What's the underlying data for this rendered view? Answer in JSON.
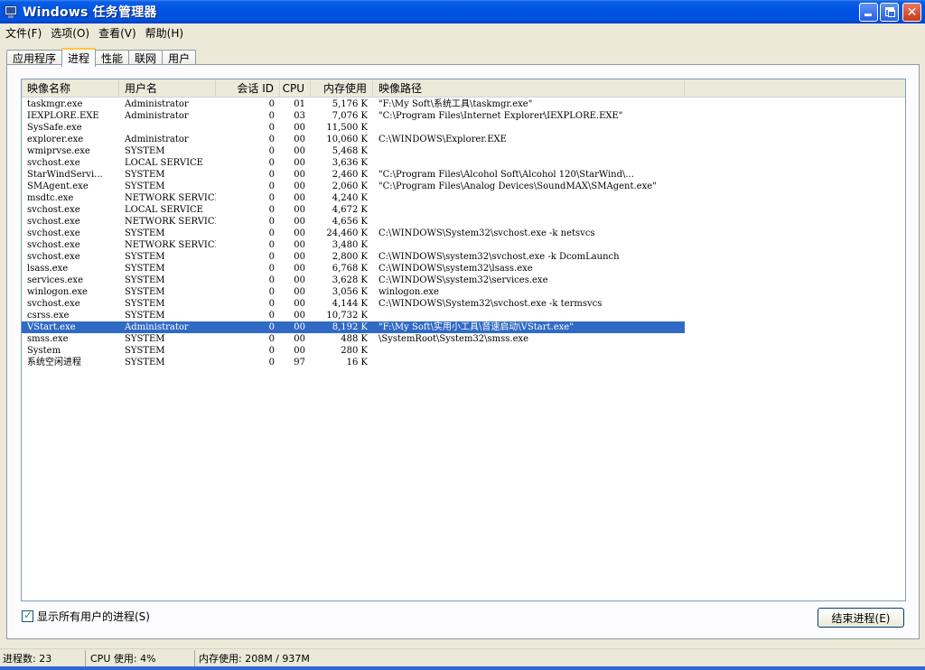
{
  "window": {
    "title": "Windows 任务管理器"
  },
  "menu": [
    "文件(F)",
    "选项(O)",
    "查看(V)",
    "帮助(H)"
  ],
  "tabs": [
    "应用程序",
    "进程",
    "性能",
    "联网",
    "用户"
  ],
  "active_tab": 1,
  "columns": [
    "映像名称",
    "用户名",
    "会话 ID",
    "CPU",
    "内存使用",
    "映像路径"
  ],
  "processes": [
    {
      "name": "taskmgr.exe",
      "user": "Administrator",
      "session": "0",
      "cpu": "01",
      "mem": "5,176 K",
      "path": "\"F:\\My Soft\\系统工具\\taskmgr.exe\""
    },
    {
      "name": "IEXPLORE.EXE",
      "user": "Administrator",
      "session": "0",
      "cpu": "03",
      "mem": "7,076 K",
      "path": "\"C:\\Program Files\\Internet Explorer\\IEXPLORE.EXE\""
    },
    {
      "name": "SysSafe.exe",
      "user": "",
      "session": "0",
      "cpu": "00",
      "mem": "11,500 K",
      "path": ""
    },
    {
      "name": "explorer.exe",
      "user": "Administrator",
      "session": "0",
      "cpu": "00",
      "mem": "10,060 K",
      "path": "C:\\WINDOWS\\Explorer.EXE"
    },
    {
      "name": "wmiprvse.exe",
      "user": "SYSTEM",
      "session": "0",
      "cpu": "00",
      "mem": "5,468 K",
      "path": ""
    },
    {
      "name": "svchost.exe",
      "user": "LOCAL SERVICE",
      "session": "0",
      "cpu": "00",
      "mem": "3,636 K",
      "path": ""
    },
    {
      "name": "StarWindServi...",
      "user": "SYSTEM",
      "session": "0",
      "cpu": "00",
      "mem": "2,460 K",
      "path": "\"C:\\Program Files\\Alcohol Soft\\Alcohol 120\\StarWind\\..."
    },
    {
      "name": "SMAgent.exe",
      "user": "SYSTEM",
      "session": "0",
      "cpu": "00",
      "mem": "2,060 K",
      "path": "\"C:\\Program Files\\Analog Devices\\SoundMAX\\SMAgent.exe\""
    },
    {
      "name": "msdtc.exe",
      "user": "NETWORK SERVICE",
      "session": "0",
      "cpu": "00",
      "mem": "4,240 K",
      "path": ""
    },
    {
      "name": "svchost.exe",
      "user": "LOCAL SERVICE",
      "session": "0",
      "cpu": "00",
      "mem": "4,672 K",
      "path": ""
    },
    {
      "name": "svchost.exe",
      "user": "NETWORK SERVICE",
      "session": "0",
      "cpu": "00",
      "mem": "4,656 K",
      "path": ""
    },
    {
      "name": "svchost.exe",
      "user": "SYSTEM",
      "session": "0",
      "cpu": "00",
      "mem": "24,460 K",
      "path": "C:\\WINDOWS\\System32\\svchost.exe -k netsvcs"
    },
    {
      "name": "svchost.exe",
      "user": "NETWORK SERVICE",
      "session": "0",
      "cpu": "00",
      "mem": "3,480 K",
      "path": ""
    },
    {
      "name": "svchost.exe",
      "user": "SYSTEM",
      "session": "0",
      "cpu": "00",
      "mem": "2,800 K",
      "path": "C:\\WINDOWS\\system32\\svchost.exe -k DcomLaunch"
    },
    {
      "name": "lsass.exe",
      "user": "SYSTEM",
      "session": "0",
      "cpu": "00",
      "mem": "6,768 K",
      "path": "C:\\WINDOWS\\system32\\lsass.exe"
    },
    {
      "name": "services.exe",
      "user": "SYSTEM",
      "session": "0",
      "cpu": "00",
      "mem": "3,628 K",
      "path": "C:\\WINDOWS\\system32\\services.exe"
    },
    {
      "name": "winlogon.exe",
      "user": "SYSTEM",
      "session": "0",
      "cpu": "00",
      "mem": "3,056 K",
      "path": "winlogon.exe"
    },
    {
      "name": "svchost.exe",
      "user": "SYSTEM",
      "session": "0",
      "cpu": "00",
      "mem": "4,144 K",
      "path": "C:\\WINDOWS\\System32\\svchost.exe -k termsvcs"
    },
    {
      "name": "csrss.exe",
      "user": "SYSTEM",
      "session": "0",
      "cpu": "00",
      "mem": "10,732 K",
      "path": ""
    },
    {
      "name": "VStart.exe",
      "user": "Administrator",
      "session": "0",
      "cpu": "00",
      "mem": "8,192 K",
      "path": "\"F:\\My Soft\\实用小工具\\音速启动\\VStart.exe\"",
      "selected": true
    },
    {
      "name": "smss.exe",
      "user": "SYSTEM",
      "session": "0",
      "cpu": "00",
      "mem": "488 K",
      "path": "\\SystemRoot\\System32\\smss.exe"
    },
    {
      "name": "System",
      "user": "SYSTEM",
      "session": "0",
      "cpu": "00",
      "mem": "280 K",
      "path": ""
    },
    {
      "name": "系统空闲进程",
      "user": "SYSTEM",
      "session": "0",
      "cpu": "97",
      "mem": "16 K",
      "path": ""
    }
  ],
  "show_all_users": {
    "label": "显示所有用户的进程(S)",
    "checked": true
  },
  "end_process_label": "结束进程(E)",
  "status": {
    "processes": "进程数: 23",
    "cpu": "CPU 使用: 4%",
    "memory": "内存使用: 208M / 937M"
  },
  "colors": {
    "titlebar": "#0054e3",
    "selection": "#316ac5",
    "active_tab_accent": "#ffc83c"
  },
  "icons": {
    "app": "task-manager-icon",
    "minimize": "minimize-icon",
    "restore": "restore-icon",
    "close": "close-icon",
    "check": "checkmark-icon"
  }
}
